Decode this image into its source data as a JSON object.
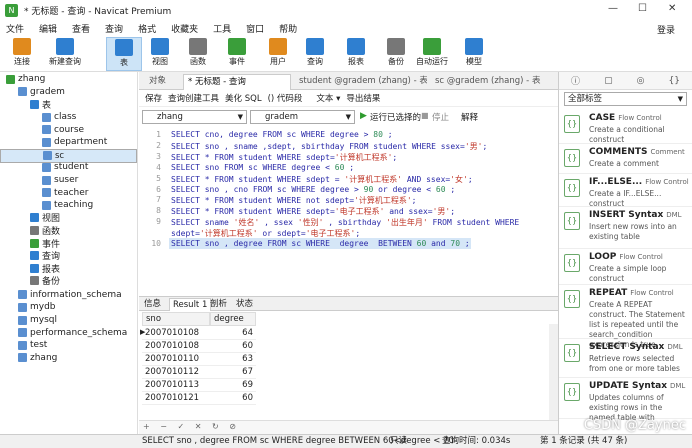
{
  "window": {
    "title": "* 无标题 - 查询 - Navicat Premium",
    "controls": [
      "—",
      "☐",
      "✕"
    ]
  },
  "menu": {
    "items": [
      "文件",
      "编辑",
      "查看",
      "查询",
      "格式",
      "收藏夹",
      "工具",
      "窗口",
      "帮助"
    ],
    "login": "登录"
  },
  "toolbar": {
    "items": [
      {
        "label": "连接",
        "icon": "connection-icon",
        "color": "#e08a1e"
      },
      {
        "label": "新建查询",
        "icon": "new-query-icon",
        "color": "#2f7fd0"
      },
      {
        "label": "表",
        "icon": "table-icon",
        "color": "#2f7fd0"
      },
      {
        "label": "视图",
        "icon": "view-icon",
        "color": "#2f7fd0"
      },
      {
        "label": "函数",
        "icon": "function-icon",
        "color": "#777777"
      },
      {
        "label": "事件",
        "icon": "event-icon",
        "color": "#3a9e3a"
      },
      {
        "label": "用户",
        "icon": "user-icon",
        "color": "#e08a1e"
      },
      {
        "label": "查询",
        "icon": "query-icon",
        "color": "#2f7fd0"
      },
      {
        "label": "报表",
        "icon": "report-icon",
        "color": "#2f7fd0"
      },
      {
        "label": "备份",
        "icon": "backup-icon",
        "color": "#777777"
      },
      {
        "label": "自动运行",
        "icon": "schedule-icon",
        "color": "#3a9e3a"
      },
      {
        "label": "模型",
        "icon": "model-icon",
        "color": "#2f7fd0"
      }
    ]
  },
  "sidebar": {
    "items": [
      {
        "label": "zhang",
        "level": 0,
        "icon": "connection-icon"
      },
      {
        "label": "gradem",
        "level": 1,
        "icon": "database-icon"
      },
      {
        "label": "表",
        "level": 2,
        "icon": "tables-folder-icon"
      },
      {
        "label": "class",
        "level": 3,
        "icon": "table-icon"
      },
      {
        "label": "course",
        "level": 3,
        "icon": "table-icon"
      },
      {
        "label": "department",
        "level": 3,
        "icon": "table-icon"
      },
      {
        "label": "sc",
        "level": 3,
        "icon": "table-icon",
        "selected": true
      },
      {
        "label": "student",
        "level": 3,
        "icon": "table-icon"
      },
      {
        "label": "suser",
        "level": 3,
        "icon": "table-icon"
      },
      {
        "label": "teacher",
        "level": 3,
        "icon": "table-icon"
      },
      {
        "label": "teaching",
        "level": 3,
        "icon": "table-icon"
      },
      {
        "label": "视图",
        "level": 2,
        "icon": "view-icon"
      },
      {
        "label": "函数",
        "level": 2,
        "icon": "function-icon"
      },
      {
        "label": "事件",
        "level": 2,
        "icon": "event-icon"
      },
      {
        "label": "查询",
        "level": 2,
        "icon": "query-icon"
      },
      {
        "label": "报表",
        "level": 2,
        "icon": "report-icon"
      },
      {
        "label": "备份",
        "level": 2,
        "icon": "backup-icon"
      },
      {
        "label": "information_schema",
        "level": 1,
        "icon": "database-icon"
      },
      {
        "label": "mydb",
        "level": 1,
        "icon": "database-icon"
      },
      {
        "label": "mysql",
        "level": 1,
        "icon": "database-icon"
      },
      {
        "label": "performance_schema",
        "level": 1,
        "icon": "database-icon"
      },
      {
        "label": "test",
        "level": 1,
        "icon": "database-icon"
      },
      {
        "label": "zhang",
        "level": 1,
        "icon": "database-icon"
      }
    ]
  },
  "tabs": [
    "对象",
    "* 无标题 - 查询",
    "student @gradem (zhang) - 表",
    "sc @gradem (zhang) - 表"
  ],
  "query_toolbar": {
    "save": "保存",
    "builder": "查询创建工具",
    "beautify": "美化 SQL",
    "snippet": "() 代码段",
    "text": "文本 ▾",
    "export": "导出结果"
  },
  "selectors": {
    "connection": "zhang",
    "database": "gradem",
    "run_selected": "运行已选择的",
    "stop": "停止",
    "explain": "解释"
  },
  "editor": {
    "lines": [
      {
        "n": "1",
        "parts": [
          [
            "kw",
            "SELECT cno, degree FROM sc WHERE degree > "
          ],
          [
            "num",
            "80"
          ],
          [
            "kw",
            " ;"
          ]
        ]
      },
      {
        "n": "2",
        "parts": [
          [
            "kw",
            "SELECT sno , sname ,sdept, sbirthday FROM student WHERE ssex="
          ],
          [
            "str",
            "'男'"
          ],
          [
            "kw",
            ";"
          ]
        ]
      },
      {
        "n": "3",
        "parts": [
          [
            "kw",
            "SELECT * FROM student WHERE sdept="
          ],
          [
            "str",
            "'计算机工程系'"
          ],
          [
            "kw",
            ";"
          ]
        ]
      },
      {
        "n": "4",
        "parts": [
          [
            "kw",
            "SELECT sno FROM sc WHERE degree < "
          ],
          [
            "num",
            "60"
          ],
          [
            "kw",
            " ;"
          ]
        ]
      },
      {
        "n": "5",
        "parts": [
          [
            "kw",
            "SELECT * FROM student WHERE sdept = "
          ],
          [
            "str",
            "'计算机工程系'"
          ],
          [
            "kw",
            " AND ssex="
          ],
          [
            "str",
            "'女'"
          ],
          [
            "kw",
            ";"
          ]
        ]
      },
      {
        "n": "6",
        "parts": [
          [
            "kw",
            "SELECT sno , cno FROM sc WHERE degree > "
          ],
          [
            "num",
            "90"
          ],
          [
            "kw",
            " or degree < "
          ],
          [
            "num",
            "60"
          ],
          [
            "kw",
            " ;"
          ]
        ]
      },
      {
        "n": "7",
        "parts": [
          [
            "kw",
            "SELECT * FROM student WHERE not sdept="
          ],
          [
            "str",
            "'计算机工程系'"
          ],
          [
            "kw",
            ";"
          ]
        ]
      },
      {
        "n": "8",
        "parts": [
          [
            "kw",
            "SELECT * FROM student WHERE sdept="
          ],
          [
            "str",
            "'电子工程系'"
          ],
          [
            "kw",
            " and ssex="
          ],
          [
            "str",
            "'男'"
          ],
          [
            "kw",
            ";"
          ]
        ]
      },
      {
        "n": "9",
        "parts": [
          [
            "kw",
            "SELECT sname "
          ],
          [
            "str",
            "'姓名'"
          ],
          [
            "kw",
            " , ssex "
          ],
          [
            "str",
            "'性别'"
          ],
          [
            "kw",
            " , sbirthday "
          ],
          [
            "str",
            "'出生年月'"
          ],
          [
            "kw",
            " FROM student WHERE"
          ]
        ]
      },
      {
        "n": "",
        "parts": [
          [
            "kw",
            "sdept="
          ],
          [
            "str",
            "'计算机工程系'"
          ],
          [
            "kw",
            " or sdept="
          ],
          [
            "str",
            "'电子工程系'"
          ],
          [
            "kw",
            ";"
          ]
        ]
      },
      {
        "n": "10",
        "parts": [
          [
            "kw",
            "SELECT sno , degree FROM sc WHERE  degree  BETWEEN "
          ],
          [
            "num",
            "60"
          ],
          [
            "kw",
            " and "
          ],
          [
            "num",
            "70"
          ],
          [
            "kw",
            " ;"
          ]
        ],
        "highlight": true
      }
    ]
  },
  "result_tabs": [
    "信息",
    "Result 1",
    "剖析",
    "状态"
  ],
  "grid": {
    "columns": [
      "sno",
      "degree"
    ],
    "rows": [
      [
        "2007010108",
        "64"
      ],
      [
        "2007010108",
        "60"
      ],
      [
        "2007010110",
        "63"
      ],
      [
        "2007010112",
        "67"
      ],
      [
        "2007010113",
        "69"
      ],
      [
        "2007010121",
        "60"
      ]
    ]
  },
  "grid_nav": "+ − ✓ ✕ ↻ ⊘",
  "status": {
    "sql": "SELECT sno , degree FROM sc WHERE degree BETWEEN 60<degree < 70",
    "readonly": "只读",
    "time": "查询时间: 0.034s",
    "records": "第 1 条记录 (共 47 条)"
  },
  "right_panel": {
    "dropdown": "全部标签",
    "snippets": [
      {
        "title": "CASE",
        "tag": "Flow Control",
        "desc": "Create a conditional construct"
      },
      {
        "title": "COMMENTS",
        "tag": "Comment",
        "desc": "Create a comment"
      },
      {
        "title": "IF...ELSE...",
        "tag": "Flow Control",
        "desc": "Create a IF...ELSE... construct"
      },
      {
        "title": "INSERT Syntax",
        "tag": "DML",
        "desc": "Insert new rows into an existing table"
      },
      {
        "title": "LOOP",
        "tag": "Flow Control",
        "desc": "Create a simple loop construct"
      },
      {
        "title": "REPEAT",
        "tag": "Flow Control",
        "desc": "Create A REPEAT construct. The Statement list is repeated until the search_condition expression is true."
      },
      {
        "title": "SELECT Syntax",
        "tag": "DML",
        "desc": "Retrieve rows selected from one or more tables"
      },
      {
        "title": "UPDATE Syntax",
        "tag": "DML",
        "desc": "Updates columns of existing rows in the named table with"
      }
    ]
  },
  "watermark": "CSDN @Zaynec"
}
